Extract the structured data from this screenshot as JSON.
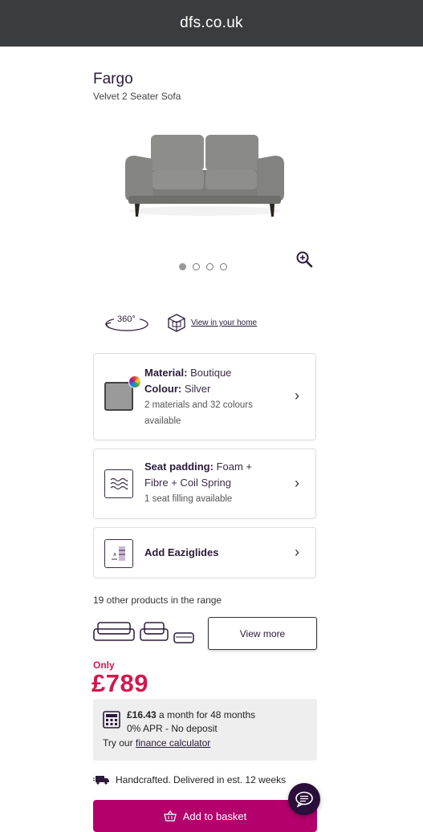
{
  "browser": {
    "url": "dfs.co.uk"
  },
  "product": {
    "name": "Fargo",
    "description": "Velvet 2 Seater Sofa",
    "gallery_count": 4,
    "gallery_active": 1
  },
  "viewer": {
    "spin_label": "360°",
    "view_in_home": "View in your home"
  },
  "options": {
    "material": {
      "label": "Material:",
      "value": "Boutique",
      "colour_label": "Colour:",
      "colour_value": "Silver",
      "note_line1": "2 materials and 32 colours",
      "note_line2": "available",
      "swatch_color": "#9a9a9a"
    },
    "padding": {
      "label": "Seat padding:",
      "value_line1": "Foam +",
      "value_line2": "Fibre + Coil Spring",
      "note": "1 seat filling available"
    },
    "glides": {
      "label": "Add Eaziglides"
    }
  },
  "range": {
    "text": "19 other products in the range",
    "view_more": "View more"
  },
  "price": {
    "prefix": "Only",
    "amount": "£789",
    "color": "#d3174c"
  },
  "finance": {
    "monthly": "£16.43",
    "monthly_rest": "a month for 48 months",
    "apr": "0% APR - No deposit",
    "try_prefix": "Try our",
    "calculator_link": "finance calculator"
  },
  "delivery": {
    "text": "Handcrafted. Delivered in est. 12 weeks"
  },
  "cta": {
    "add_to_basket": "Add to basket",
    "color": "#b3006c"
  },
  "icons": {
    "zoom": "zoom-in-icon",
    "spin": "rotate-360-icon",
    "ar": "ar-box-icon",
    "padding": "waves-icon",
    "glides": "glides-icon",
    "calculator": "calculator-icon",
    "truck": "truck-icon",
    "basket": "basket-icon",
    "chat": "chat-icon"
  }
}
